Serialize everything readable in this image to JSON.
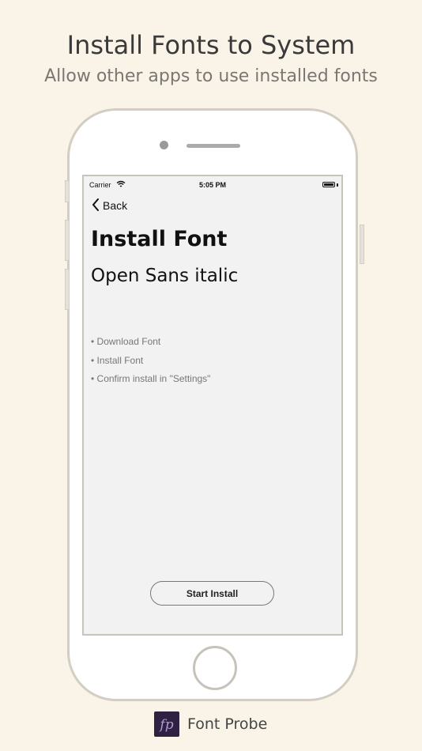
{
  "marketing": {
    "headline": "Install Fonts to System",
    "subheadline": "Allow other apps to use installed fonts"
  },
  "status_bar": {
    "carrier": "Carrier",
    "time": "5:05 PM",
    "icons": [
      "wifi-icon",
      "battery-icon"
    ]
  },
  "nav": {
    "back_label": "Back",
    "back_icon": "chevron-left-icon"
  },
  "screen": {
    "title": "Install Font",
    "font_name": "Open Sans italic",
    "steps": [
      "• Download Font",
      "• Install Font",
      "• Confirm install in \"Settings\""
    ],
    "start_button_label": "Start Install"
  },
  "footer": {
    "app_name": "Font Probe",
    "app_icon": "font-probe-logo-icon"
  },
  "colors": {
    "background": "#faf3e7",
    "screen_background": "#f2f2f2",
    "logo_background": "#2f2142",
    "logo_glyph": "#b59ad6"
  }
}
